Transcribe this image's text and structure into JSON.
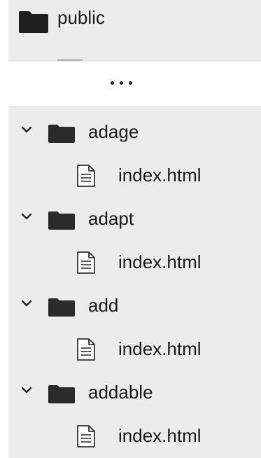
{
  "root": {
    "label": "public",
    "icon": "folder-icon"
  },
  "overflow": {
    "icon": "ellipsis-icon"
  },
  "tree": [
    {
      "folder": "adage",
      "expanded": true,
      "file": "index.html"
    },
    {
      "folder": "adapt",
      "expanded": true,
      "file": "index.html"
    },
    {
      "folder": "add",
      "expanded": true,
      "file": "index.html"
    },
    {
      "folder": "addable",
      "expanded": true,
      "file": "index.html"
    }
  ],
  "colors": {
    "panel": "#ececec",
    "text": "#1a1a1a",
    "folder": "#2b2b2b"
  }
}
